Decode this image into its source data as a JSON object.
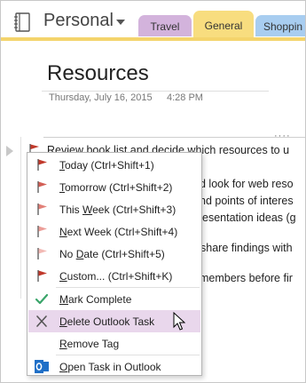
{
  "notebook": {
    "name": "Personal"
  },
  "tabs": [
    {
      "label": "Travel"
    },
    {
      "label": "General"
    },
    {
      "label": "Shoppin"
    }
  ],
  "page": {
    "title": "Resources",
    "date": "Thursday, July 16, 2015",
    "time": "4:28 PM"
  },
  "note_lines": [
    "Review book list and decide which resources to u",
    "d look for web reso",
    "nd points of interes",
    "esentation ideas (g",
    "share findings with",
    "members before fir"
  ],
  "menu": {
    "items": [
      {
        "accel": "T",
        "rest": "oday",
        "shortcut": "(Ctrl+Shift+1)",
        "flag_color": "#c0392b"
      },
      {
        "accel": "T",
        "rest": "omorrow",
        "shortcut": "(Ctrl+Shift+2)",
        "flag_color": "#d25e55"
      },
      {
        "pre": "This ",
        "accel": "W",
        "rest": "eek",
        "shortcut": "(Ctrl+Shift+3)",
        "flag_color": "#e28078"
      },
      {
        "accel": "N",
        "rest": "ext Week",
        "shortcut": "(Ctrl+Shift+4)",
        "flag_color": "#ec9e98"
      },
      {
        "pre": "No ",
        "accel": "D",
        "rest": "ate",
        "shortcut": "(Ctrl+Shift+5)",
        "flag_color": "#f2b9b4"
      },
      {
        "accel": "C",
        "rest": "ustom...",
        "shortcut": "(Ctrl+Shift+K)",
        "flag_color": "#c0392b"
      },
      {
        "accel": "M",
        "rest": "ark Complete",
        "icon": "checkmark-icon",
        "icon_color": "#3aa56a"
      },
      {
        "accel": "D",
        "rest": "elete Outlook Task",
        "icon": "x-icon",
        "highlighted": true
      },
      {
        "accel": "R",
        "rest": "emove Tag"
      },
      {
        "accel": "O",
        "rest": "pen Task in Outlook",
        "icon": "outlook-icon",
        "icon_color": "#1f6fc7"
      }
    ]
  },
  "colors": {
    "accent_bar": "#f4d46c",
    "menu_highlight": "#e9d7ec"
  }
}
